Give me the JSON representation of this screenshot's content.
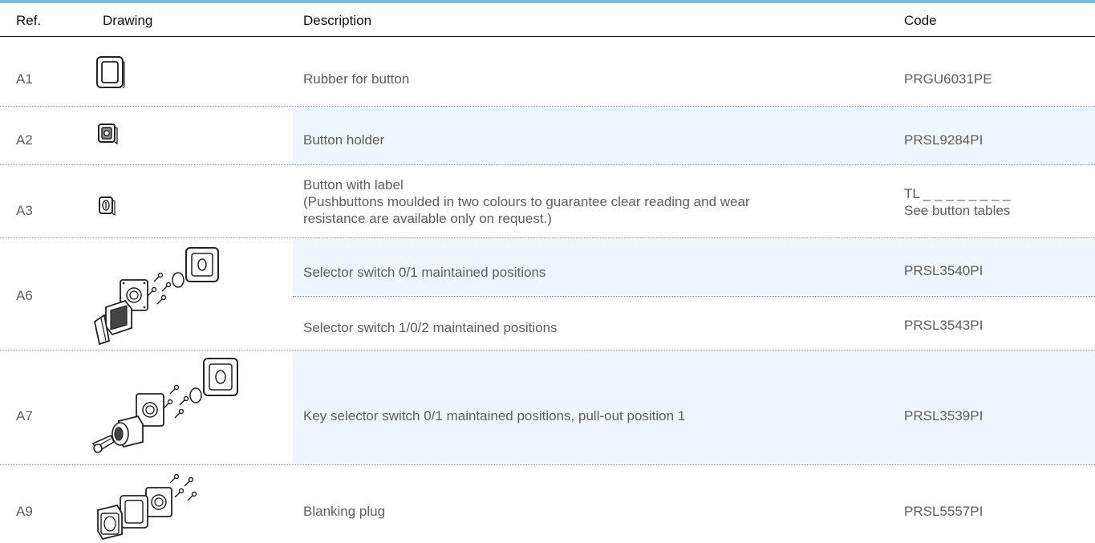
{
  "colors": {
    "accent": "#6cc4ea",
    "row_shade": "#eef6fc",
    "header_rule": "#1a1a1a"
  },
  "header": {
    "ref": "Ref.",
    "drawing": "Drawing",
    "description": "Description",
    "code": "Code"
  },
  "rows": [
    {
      "ref": "A1",
      "drawing_icon": "rubber-gasket-icon",
      "description": "Rubber for button",
      "code": "PRGU6031PE"
    },
    {
      "ref": "A2",
      "drawing_icon": "button-holder-icon",
      "description": "Button holder",
      "code": "PRSL9284PI"
    },
    {
      "ref": "A3",
      "drawing_icon": "label-button-icon",
      "description_lines": [
        "Button with label",
        "(Pushbuttons moulded in two colours to guarantee clear reading and wear",
        "resistance are available only on request.)"
      ],
      "code_lines": [
        "TL _ _ _ _ _ _ _ _",
        "See button tables"
      ]
    },
    {
      "ref": "A6",
      "drawing_icon": "selector-switch-exploded-icon",
      "sub": [
        {
          "description": "Selector switch 0/1 maintained positions",
          "code": "PRSL3540PI"
        },
        {
          "description": "Selector switch 1/0/2 maintained positions",
          "code": "PRSL3543PI"
        }
      ]
    },
    {
      "ref": "A7",
      "drawing_icon": "key-selector-exploded-icon",
      "description": "Key selector switch 0/1 maintained positions, pull-out position 1",
      "code": "PRSL3539PI"
    },
    {
      "ref": "A9",
      "drawing_icon": "blanking-plug-exploded-icon",
      "description": "Blanking plug",
      "code": "PRSL5557PI"
    }
  ]
}
